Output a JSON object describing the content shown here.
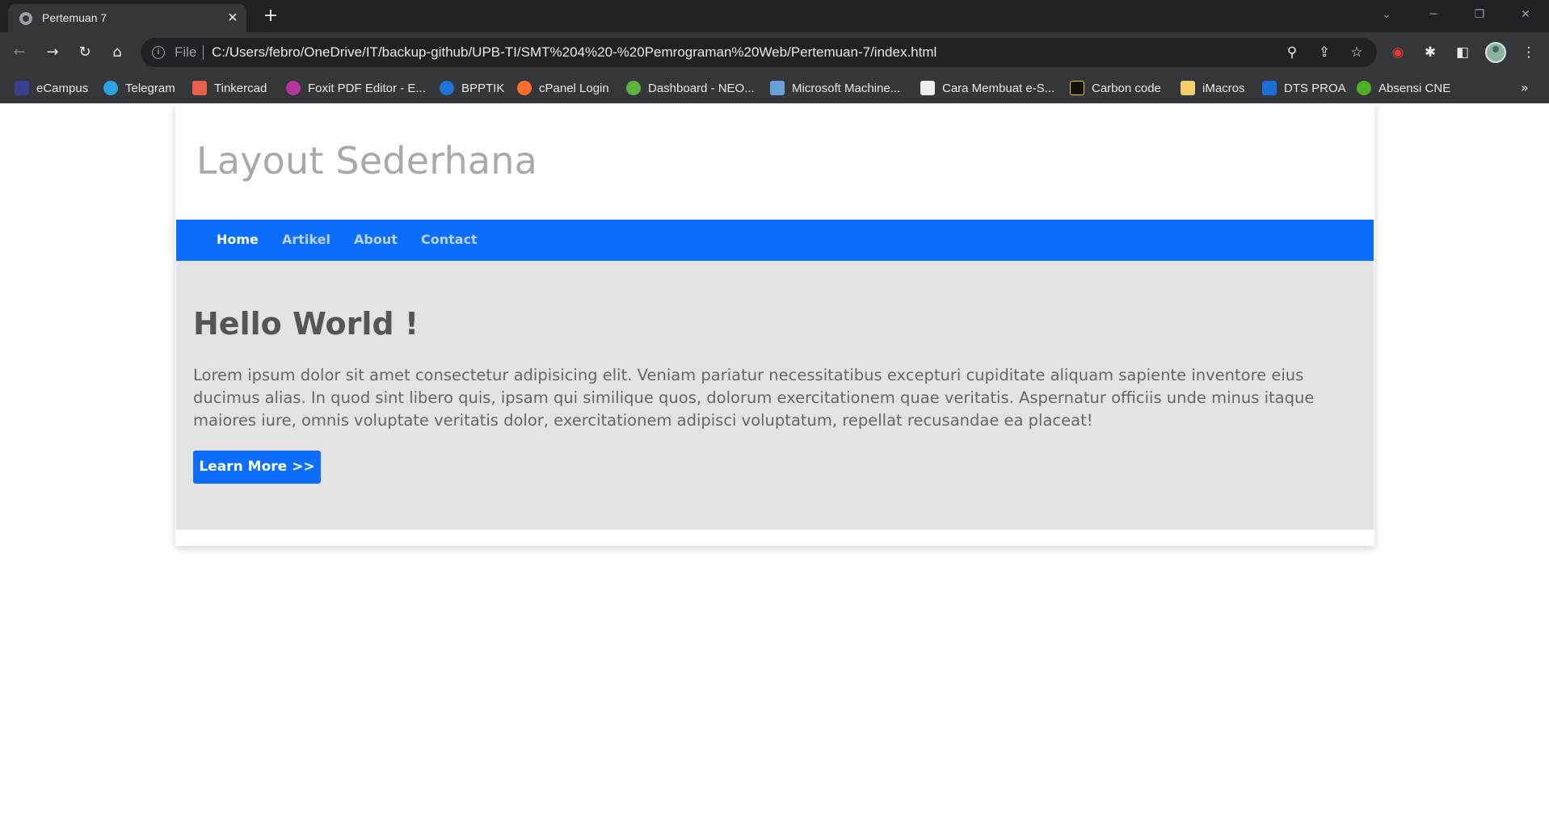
{
  "browser": {
    "tab_title": "Pertemuan 7",
    "file_label": "File",
    "url": "C:/Users/febro/OneDrive/IT/backup-github/UPB-TI/SMT%204%20-%20Pemrograman%20Web/Pertemuan-7/index.html",
    "bookmarks": [
      {
        "label": "eCampus",
        "color": "#3b3f8f"
      },
      {
        "label": "Telegram",
        "color": "#2aa3e0"
      },
      {
        "label": "Tinkercad",
        "color": "#e8604c"
      },
      {
        "label": "Foxit PDF Editor - E...",
        "color": "#b4359c"
      },
      {
        "label": "BPPTIK",
        "color": "#1e73d8"
      },
      {
        "label": "cPanel Login",
        "color": "#ff6c2c"
      },
      {
        "label": "Dashboard - NEO...",
        "color": "#5fb33f"
      },
      {
        "label": "Microsoft Machine...",
        "color": "#6aa0d8"
      },
      {
        "label": "Cara Membuat e-S...",
        "color": "#eeeeee"
      },
      {
        "label": "Carbon code",
        "color": "#111111"
      },
      {
        "label": "iMacros",
        "color": "#f5d06a"
      },
      {
        "label": "DTS PROA",
        "color": "#1d6fd6"
      },
      {
        "label": "Absensi CNE",
        "color": "#4caf1f"
      }
    ]
  },
  "page": {
    "site_title": "Layout Sederhana",
    "nav": [
      {
        "label": "Home",
        "active": true
      },
      {
        "label": "Artikel",
        "active": false
      },
      {
        "label": "About",
        "active": false
      },
      {
        "label": "Contact",
        "active": false
      }
    ],
    "hero": {
      "title": "Hello World !",
      "text": "Lorem ipsum dolor sit amet consectetur adipisicing elit. Veniam pariatur necessitatibus excepturi cupiditate aliquam sapiente inventore eius ducimus alias. In quod sint libero quis, ipsam qui similique quos, dolorum exercitationem quae veritatis. Aspernatur officiis unde minus itaque maiores iure, omnis voluptate veritatis dolor, exercitationem adipisci voluptatum, repellat recusandae ea placeat!",
      "button_label": "Learn More >>"
    },
    "colors": {
      "primary": "#0d6efd",
      "hero_bg": "#e3e3e3",
      "title_gray": "#a9a9a9"
    }
  }
}
